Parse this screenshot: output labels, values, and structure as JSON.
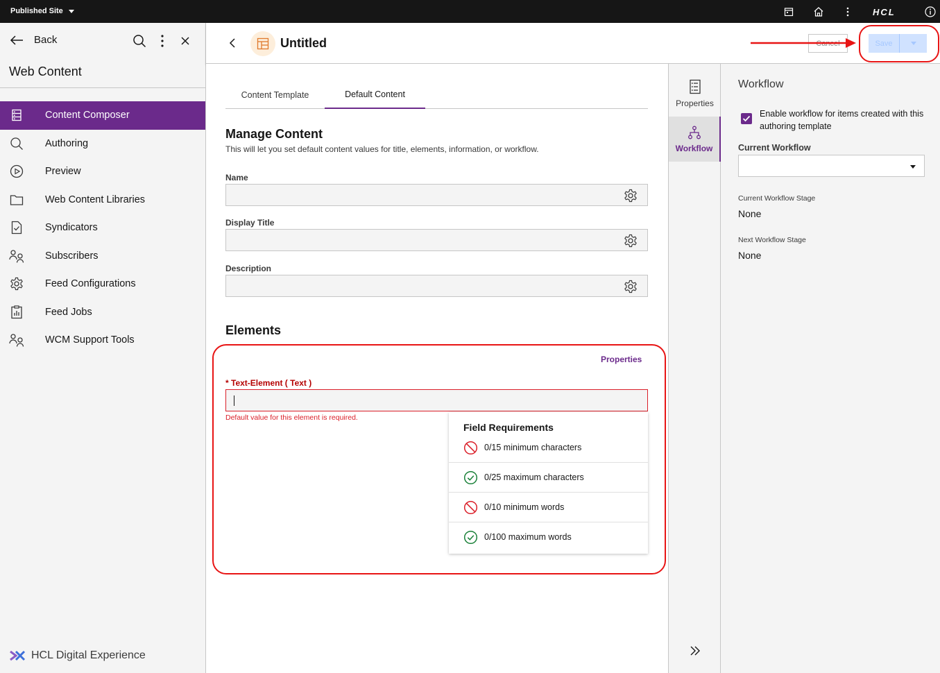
{
  "topbar": {
    "site_label": "Published Site",
    "brand": "HCL",
    "icons": [
      "calendar-icon",
      "home-icon",
      "overflow-menu-icon",
      "info-icon"
    ]
  },
  "sidebar": {
    "back_label": "Back",
    "title": "Web Content",
    "items": [
      {
        "label": "Content Composer",
        "icon": "list-icon",
        "active": true
      },
      {
        "label": "Authoring",
        "icon": "search-icon"
      },
      {
        "label": "Preview",
        "icon": "play-icon"
      },
      {
        "label": "Web Content Libraries",
        "icon": "folder-icon"
      },
      {
        "label": "Syndicators",
        "icon": "document-check-icon"
      },
      {
        "label": "Subscribers",
        "icon": "users-icon"
      },
      {
        "label": "Feed Configurations",
        "icon": "gear-icon"
      },
      {
        "label": "Feed Jobs",
        "icon": "clipboard-icon"
      },
      {
        "label": "WCM Support Tools",
        "icon": "users-icon"
      }
    ],
    "footer_brand": "HCL Digital Experience"
  },
  "header": {
    "title": "Untitled",
    "cancel_label": "Cancel",
    "save_label": "Save"
  },
  "main": {
    "tabs": [
      {
        "label": "Content Template"
      },
      {
        "label": "Default Content",
        "active": true
      }
    ],
    "manage_title": "Manage Content",
    "manage_desc": "This will let you set default content values for title, elements, information, or workflow.",
    "fields": [
      {
        "label": "Name",
        "value": ""
      },
      {
        "label": "Display Title",
        "value": ""
      },
      {
        "label": "Description",
        "value": ""
      }
    ],
    "elements_title": "Elements",
    "properties_link": "Properties",
    "text_element_label": "* Text-Element ( Text )",
    "text_element_value": "",
    "text_element_error": "Default value for this element is required.",
    "requirements": {
      "title": "Field Requirements",
      "items": [
        {
          "text": "0/15 minimum characters",
          "status": "fail"
        },
        {
          "text": "0/25 maximum characters",
          "status": "pass"
        },
        {
          "text": "0/10 minimum words",
          "status": "fail"
        },
        {
          "text": "0/100 maximum words",
          "status": "pass"
        }
      ]
    }
  },
  "rail": {
    "items": [
      {
        "label": "Properties",
        "icon": "list-icon"
      },
      {
        "label": "Workflow",
        "icon": "workflow-icon",
        "active": true
      }
    ]
  },
  "workflow": {
    "title": "Workflow",
    "enable_label": "Enable workflow for items created with this authoring template",
    "enable_checked": true,
    "current_workflow_label": "Current Workflow",
    "current_workflow_value": "",
    "current_stage_label": "Current Workflow Stage",
    "current_stage_value": "None",
    "next_stage_label": "Next Workflow Stage",
    "next_stage_value": "None"
  },
  "colors": {
    "accent": "#6b2a8b",
    "error": "#da1e28",
    "annotation": "#e81414",
    "pass": "#24a148"
  }
}
